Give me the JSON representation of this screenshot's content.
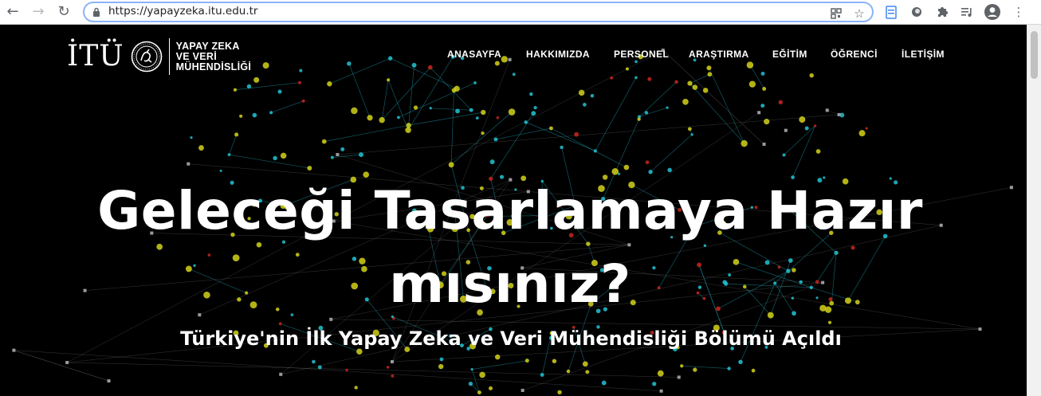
{
  "browser": {
    "url": "https://yapayzeka.itu.edu.tr",
    "icons": {
      "back": "arrow-left-icon",
      "forward": "arrow-right-icon",
      "reload": "reload-icon",
      "lock": "lock-icon",
      "qr": "qr-code-icon",
      "bookmark": "star-icon",
      "extensions": [
        "document-extension-icon",
        "circle-extension-icon",
        "puzzle-icon",
        "media-queue-icon"
      ],
      "profile": "profile-icon",
      "menu": "kebab-menu-icon"
    }
  },
  "header": {
    "logo_text": "İTÜ",
    "dept_line1": "YAPAY ZEKA",
    "dept_line2": "VE VERİ",
    "dept_line3": "MÜHENDİSLİĞİ"
  },
  "nav": {
    "items": [
      {
        "label": "ANASAYFA"
      },
      {
        "label": "HAKKIMIZDA"
      },
      {
        "label": "PERSONEL"
      },
      {
        "label": "ARAŞTIRMA"
      },
      {
        "label": "EĞİTİM"
      },
      {
        "label": "ÖĞRENCİ"
      },
      {
        "label": "İLETİŞİM"
      }
    ]
  },
  "hero": {
    "title_line1": "Geleceği Tasarlamaya Hazır",
    "title_line2": "mısınız?",
    "subtitle": "Türkiye'nin İlk Yapay Zeka ve Veri Mühendisliği Bölümü Açıldı"
  },
  "colors": {
    "page_bg": "#000000",
    "network_line": "#1fa3b3",
    "node_yellow": "#d4d21a",
    "node_cyan": "#22c3d4",
    "node_red": "#c8271e",
    "node_gray": "#9a9a9a",
    "omnibox_border": "#8ab4f8"
  }
}
